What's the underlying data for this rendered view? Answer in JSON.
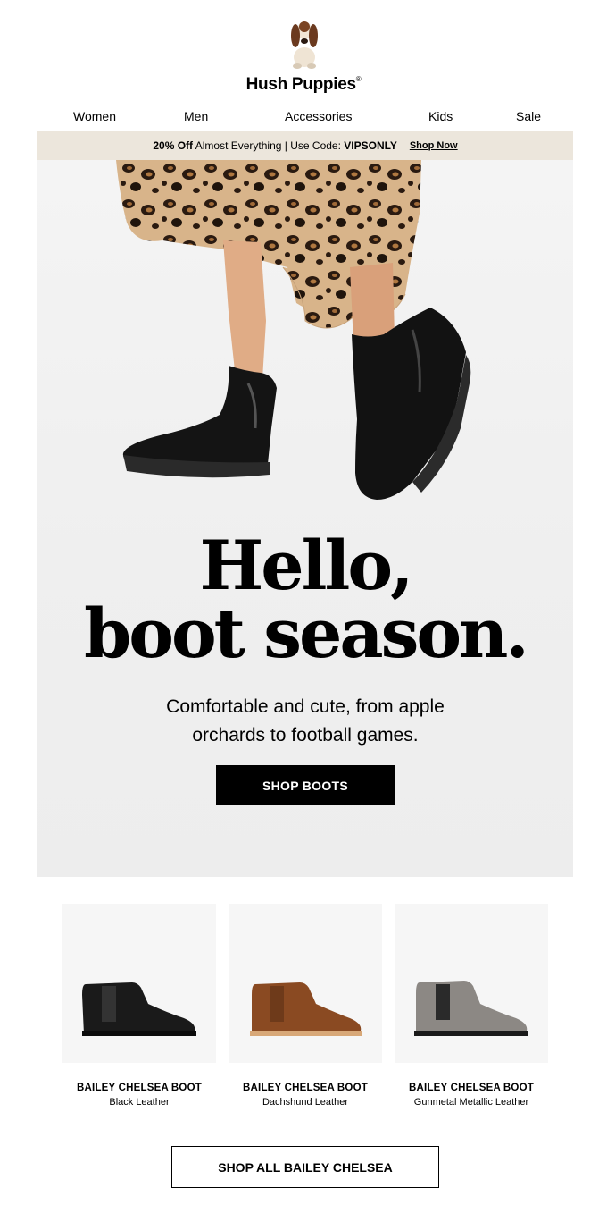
{
  "brand": {
    "name": "Hush Puppies",
    "trademark": "®"
  },
  "nav": {
    "items": [
      "Women",
      "Men",
      "Accessories",
      "Kids",
      "Sale"
    ]
  },
  "promo": {
    "discount": "20% Off",
    "text": "Almost Everything | Use Code:",
    "code": "VIPSONLY",
    "link": "Shop Now",
    "background": "#ece6dc"
  },
  "hero": {
    "headline_line1": "Hello,",
    "headline_line2": "boot season.",
    "subtext_line1": "Comfortable and cute, from apple",
    "subtext_line2": "orchards to football games.",
    "cta": "SHOP BOOTS"
  },
  "products": [
    {
      "name": "BAILEY CHELSEA BOOT",
      "color": "Black Leather",
      "swatch": "#1a1a1a"
    },
    {
      "name": "BAILEY CHELSEA BOOT",
      "color": "Dachshund Leather",
      "swatch": "#8a4a22"
    },
    {
      "name": "BAILEY CHELSEA BOOT",
      "color": "Gunmetal Metallic Leather",
      "swatch": "#8c8884"
    }
  ],
  "footer_cta": "SHOP ALL BAILEY CHELSEA"
}
